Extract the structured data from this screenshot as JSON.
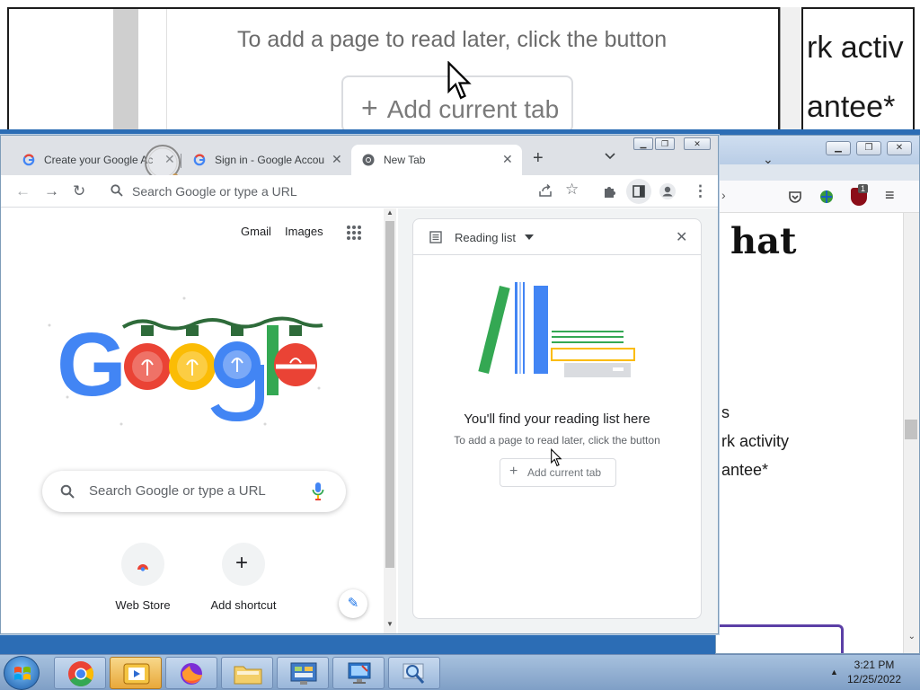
{
  "magnifier": {
    "instruction": "To add a page to read later, click the button",
    "button_label": "Add current tab",
    "right_line_1": "rk activ",
    "right_line_2": "antee*"
  },
  "chrome": {
    "tabs": [
      {
        "label": "Create your Google Ac",
        "favicon": "google-g-icon",
        "active": false
      },
      {
        "label": "Sign in - Google Accou",
        "favicon": "google-g-icon",
        "active": false
      },
      {
        "label": "New Tab",
        "favicon": "chrome-icon",
        "active": true
      }
    ],
    "new_tab_symbol": "+",
    "tab_search_symbol": "⌄",
    "omnibox_placeholder": "Search Google or type a URL",
    "window_controls": [
      "minimize",
      "restore",
      "close"
    ]
  },
  "ntp": {
    "gmail": "Gmail",
    "images": "Images",
    "search_placeholder": "Search Google or type a URL",
    "shortcuts": [
      {
        "label": "Web Store",
        "icon": "web-store-icon"
      },
      {
        "label": "Add shortcut",
        "icon": "plus-icon"
      }
    ],
    "doodle_letters": [
      "G",
      "o",
      "o",
      "g",
      "l",
      "e"
    ]
  },
  "reading_list": {
    "title": "Reading list",
    "empty_title": "You'll find your reading list here",
    "empty_subtitle": "To add a page to read later, click the button",
    "add_button": "Add current tab"
  },
  "firefox": {
    "heading": "hat",
    "lines": [
      "s",
      "rk activity",
      "antee*"
    ],
    "badge": "1"
  },
  "taskbar": {
    "time": "3:21 PM",
    "date": "12/25/2022",
    "apps": [
      "chrome",
      "media-player",
      "firefox",
      "file-explorer",
      "control-panel",
      "remote-desktop",
      "magnifier"
    ],
    "active_app": "media-player"
  },
  "colors": {
    "google_blue": "#4285F4",
    "google_red": "#EA4335",
    "google_yellow": "#FBBC05",
    "google_green": "#34A853",
    "taskbar": "#8fb0d6"
  }
}
